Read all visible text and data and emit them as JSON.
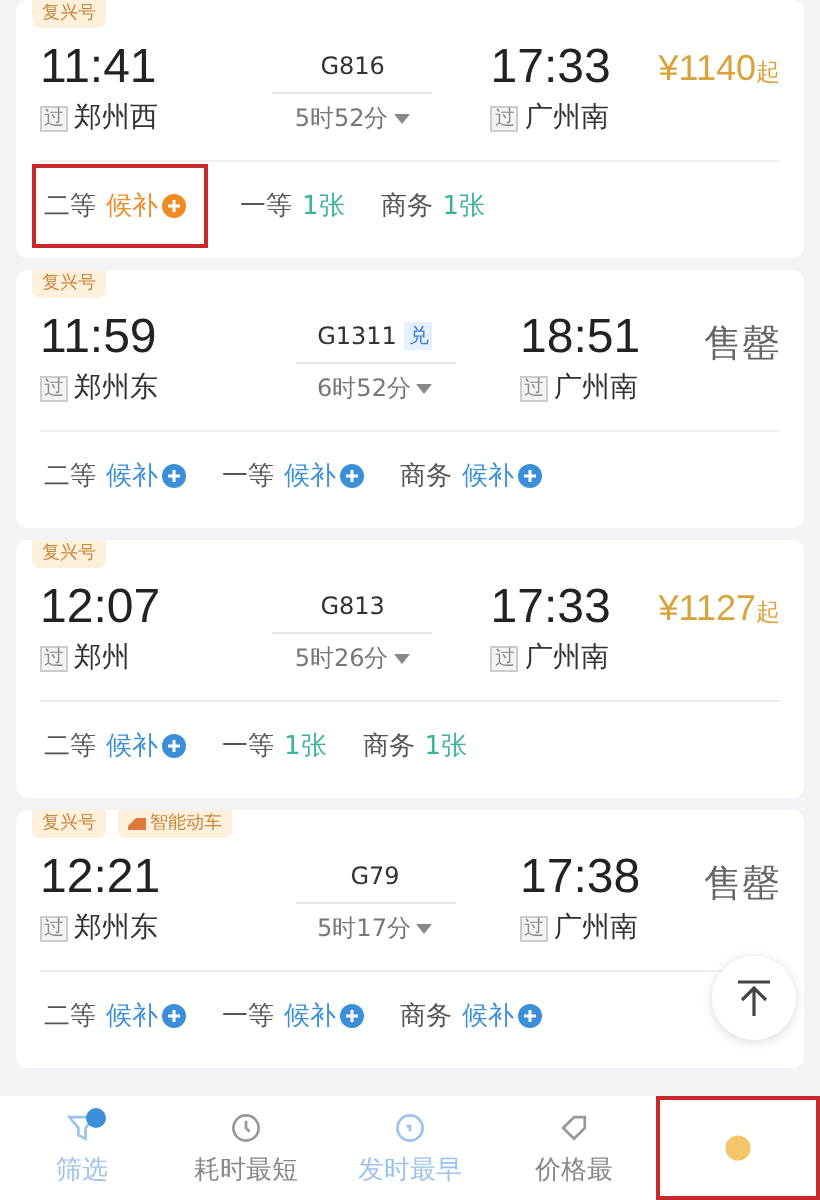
{
  "trains": [
    {
      "tags": [
        {
          "kind": "plain",
          "text": "复兴号"
        }
      ],
      "depart": {
        "time": "11:41",
        "mark": "过",
        "station": "郑州西"
      },
      "train_no": "G816",
      "duration": "5时52分",
      "arrive": {
        "time": "17:33",
        "mark": "过",
        "station": "广州南"
      },
      "fare": {
        "kind": "price",
        "amount": "¥1140",
        "suffix": "起"
      },
      "seats": [
        {
          "cls": "二等",
          "status": "候补",
          "kind": "waitlist",
          "color": "#f08a24",
          "highlighted": true
        },
        {
          "cls": "一等",
          "status": "1张",
          "kind": "tickets",
          "color": "#3bb39a",
          "highlighted": false
        },
        {
          "cls": "商务",
          "status": "1张",
          "kind": "tickets",
          "color": "#3bb39a",
          "highlighted": false
        }
      ]
    },
    {
      "tags": [
        {
          "kind": "plain",
          "text": "复兴号"
        }
      ],
      "depart": {
        "time": "11:59",
        "mark": "过",
        "station": "郑州东"
      },
      "train_no": "G1311",
      "badge": "兑",
      "duration": "6时52分",
      "arrive": {
        "time": "18:51",
        "mark": "过",
        "station": "广州南"
      },
      "fare": {
        "kind": "soldout",
        "text": "售罄"
      },
      "seats": [
        {
          "cls": "二等",
          "status": "候补",
          "kind": "waitlist",
          "color": "#3a8fd8",
          "highlighted": false
        },
        {
          "cls": "一等",
          "status": "候补",
          "kind": "waitlist",
          "color": "#3a8fd8",
          "highlighted": false
        },
        {
          "cls": "商务",
          "status": "候补",
          "kind": "waitlist",
          "color": "#3a8fd8",
          "highlighted": false
        }
      ]
    },
    {
      "tags": [
        {
          "kind": "plain",
          "text": "复兴号"
        }
      ],
      "depart": {
        "time": "12:07",
        "mark": "过",
        "station": "郑州"
      },
      "train_no": "G813",
      "duration": "5时26分",
      "arrive": {
        "time": "17:33",
        "mark": "过",
        "station": "广州南"
      },
      "fare": {
        "kind": "price",
        "amount": "¥1127",
        "suffix": "起"
      },
      "seats": [
        {
          "cls": "二等",
          "status": "候补",
          "kind": "waitlist",
          "color": "#3a8fd8",
          "highlighted": false
        },
        {
          "cls": "一等",
          "status": "1张",
          "kind": "tickets",
          "color": "#3bb39a",
          "highlighted": false
        },
        {
          "cls": "商务",
          "status": "1张",
          "kind": "tickets",
          "color": "#3bb39a",
          "highlighted": false
        }
      ]
    },
    {
      "tags": [
        {
          "kind": "plain",
          "text": "复兴号"
        },
        {
          "kind": "smart",
          "text": "智能动车"
        }
      ],
      "depart": {
        "time": "12:21",
        "mark": "过",
        "station": "郑州东"
      },
      "train_no": "G79",
      "duration": "5时17分",
      "arrive": {
        "time": "17:38",
        "mark": "过",
        "station": "广州南"
      },
      "fare": {
        "kind": "soldout",
        "text": "售罄"
      },
      "seats": [
        {
          "cls": "二等",
          "status": "候补",
          "kind": "waitlist",
          "color": "#3a8fd8",
          "highlighted": false
        },
        {
          "cls": "一等",
          "status": "候补",
          "kind": "waitlist",
          "color": "#3a8fd8",
          "highlighted": false
        },
        {
          "cls": "商务",
          "status": "候补",
          "kind": "waitlist",
          "color": "#3a8fd8",
          "highlighted": false
        }
      ]
    }
  ],
  "bottom_nav": [
    {
      "kind": "filter",
      "label": "筛选",
      "selected": true,
      "badge": true,
      "highlighted": false
    },
    {
      "kind": "clock",
      "label": "耗时最短",
      "selected": false,
      "badge": false,
      "highlighted": false
    },
    {
      "kind": "calendar",
      "label": "发时最早",
      "selected": true,
      "badge": false,
      "highlighted": false
    },
    {
      "kind": "tag",
      "label": "价格最",
      "selected": false,
      "badge": false,
      "highlighted": false
    },
    {
      "kind": "coin",
      "selected": false,
      "badge": false,
      "highlighted": true
    }
  ]
}
